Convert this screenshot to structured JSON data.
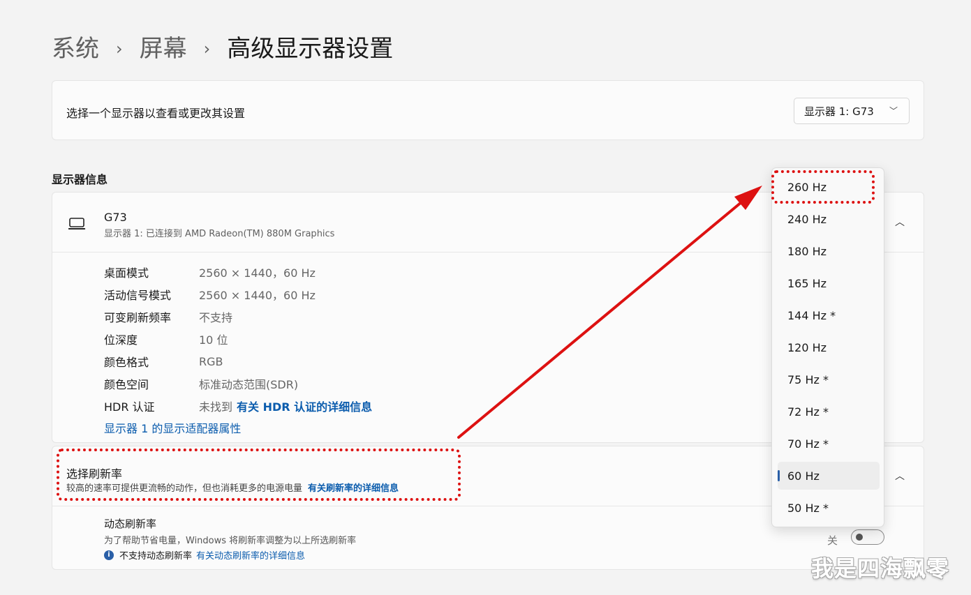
{
  "breadcrumb": {
    "items": [
      "系统",
      "屏幕",
      "高级显示器设置"
    ],
    "separator": "›"
  },
  "selector": {
    "label": "选择一个显示器以查看或更改其设置",
    "value": "显示器 1: G73"
  },
  "display_info": {
    "section_label": "显示器信息",
    "name": "G73",
    "subtitle": "显示器 1: 已连接到 AMD Radeon(TM) 880M Graphics",
    "rows": [
      {
        "key": "桌面模式",
        "value": "2560 × 1440，60 Hz"
      },
      {
        "key": "活动信号模式",
        "value": "2560 × 1440，60 Hz"
      },
      {
        "key": "可变刷新频率",
        "value": "不支持"
      },
      {
        "key": "位深度",
        "value": "10 位"
      },
      {
        "key": "颜色格式",
        "value": "RGB"
      },
      {
        "key": "颜色空间",
        "value": "标准动态范围(SDR)"
      },
      {
        "key": "HDR 认证",
        "value": "未找到",
        "link": "有关 HDR 认证的详细信息"
      }
    ],
    "adapter_link": "显示器 1 的显示适配器属性"
  },
  "refresh": {
    "title": "选择刷新率",
    "subtitle": "较高的速率可提供更流畅的动作，但也消耗更多的电源电量",
    "link": "有关刷新率的详细信息",
    "options": [
      "260 Hz",
      "240 Hz",
      "180 Hz",
      "165 Hz",
      "144 Hz *",
      "120 Hz",
      "75 Hz *",
      "72 Hz *",
      "70 Hz *",
      "60 Hz",
      "50 Hz *"
    ],
    "selected_index": 9
  },
  "dynamic": {
    "title": "动态刷新率",
    "subtitle": "为了帮助节省电量，Windows 将刷新率调整为以上所选刷新率",
    "note": "不支持动态刷新率",
    "note_link": "有关动态刷新率的详细信息",
    "toggle_label": "关",
    "toggle_on": false
  },
  "icons": {
    "chevron_right": "›",
    "chevron_down": "﹀",
    "chevron_up": "︿",
    "info": "i"
  },
  "annotation_color": "#dd1111",
  "accent_color": "#0b5cad",
  "watermark": "我是四海飘零"
}
